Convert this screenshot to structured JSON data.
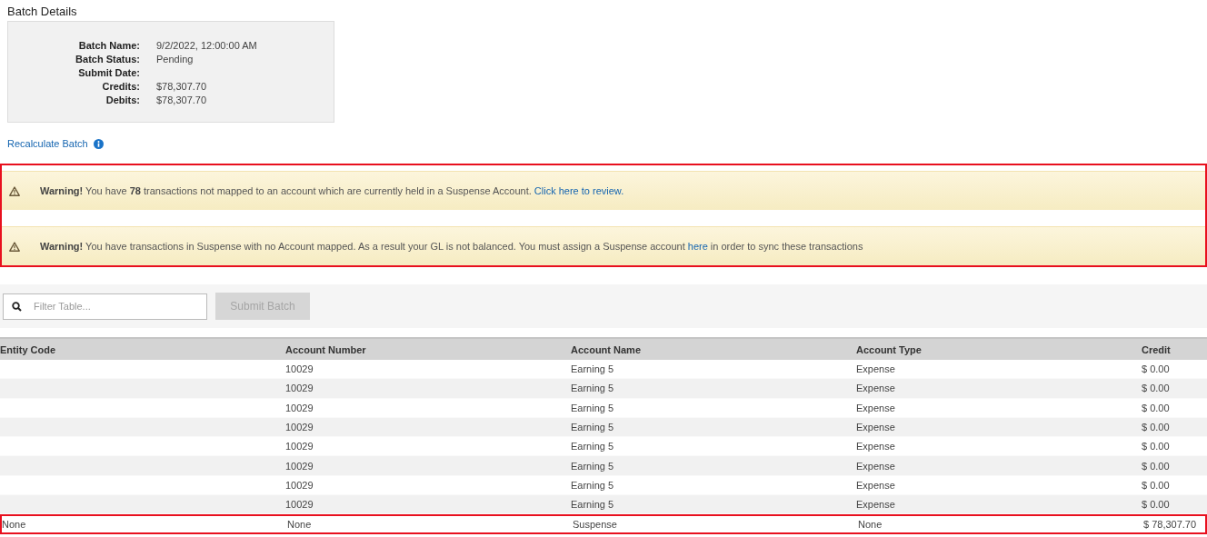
{
  "title": "Batch Details",
  "details": [
    {
      "label": "Batch Name:",
      "value": "9/2/2022, 12:00:00 AM"
    },
    {
      "label": "Batch Status:",
      "value": "Pending"
    },
    {
      "label": "Submit Date:"
    },
    {
      "label": "Credits:",
      "value": "$78,307.70"
    },
    {
      "label": "Debits:",
      "value": "$78,307.70"
    }
  ],
  "recalculate_link": "Recalculate Batch",
  "warnings_highlighted": true,
  "warnings": [
    {
      "segments": [
        {
          "kind": "text",
          "text": "**Warning!** You have **78** transactions not mapped to an account which are currently held in a Suspense Account. "
        },
        {
          "kind": "link",
          "text": "Click here to review."
        }
      ]
    },
    {
      "segments": [
        {
          "kind": "text",
          "text": "**Warning!** You have transactions in Suspense with no Account mapped. As a result your GL is not balanced. You must assign a Suspense account "
        },
        {
          "kind": "link",
          "text": "here"
        },
        {
          "kind": "text",
          "text": " in order to sync these transactions"
        }
      ]
    }
  ],
  "filter": {
    "placeholder": "Filter Table..."
  },
  "submit_button": {
    "label": "Submit Batch",
    "disabled": true
  },
  "table": {
    "columns": [
      "Entity Code",
      "Account Number",
      "Account Name",
      "Account Type",
      "Credit"
    ],
    "rows": [
      {
        "cells": [
          "",
          "10029",
          "Earning 5",
          "Expense",
          "$ 0.00"
        ],
        "highlighted": false
      },
      {
        "cells": [
          "",
          "10029",
          "Earning 5",
          "Expense",
          "$ 0.00"
        ],
        "highlighted": false
      },
      {
        "cells": [
          "",
          "10029",
          "Earning 5",
          "Expense",
          "$ 0.00"
        ],
        "highlighted": false
      },
      {
        "cells": [
          "",
          "10029",
          "Earning 5",
          "Expense",
          "$ 0.00"
        ],
        "highlighted": false
      },
      {
        "cells": [
          "",
          "10029",
          "Earning 5",
          "Expense",
          "$ 0.00"
        ],
        "highlighted": false
      },
      {
        "cells": [
          "",
          "10029",
          "Earning 5",
          "Expense",
          "$ 0.00"
        ],
        "highlighted": false
      },
      {
        "cells": [
          "",
          "10029",
          "Earning 5",
          "Expense",
          "$ 0.00"
        ],
        "highlighted": false
      },
      {
        "cells": [
          "",
          "10029",
          "Earning 5",
          "Expense",
          "$ 0.00"
        ],
        "highlighted": false
      },
      {
        "cells": [
          "None",
          "None",
          "Suspense",
          "None",
          "$ 78,307.70"
        ],
        "highlighted": true
      }
    ]
  }
}
